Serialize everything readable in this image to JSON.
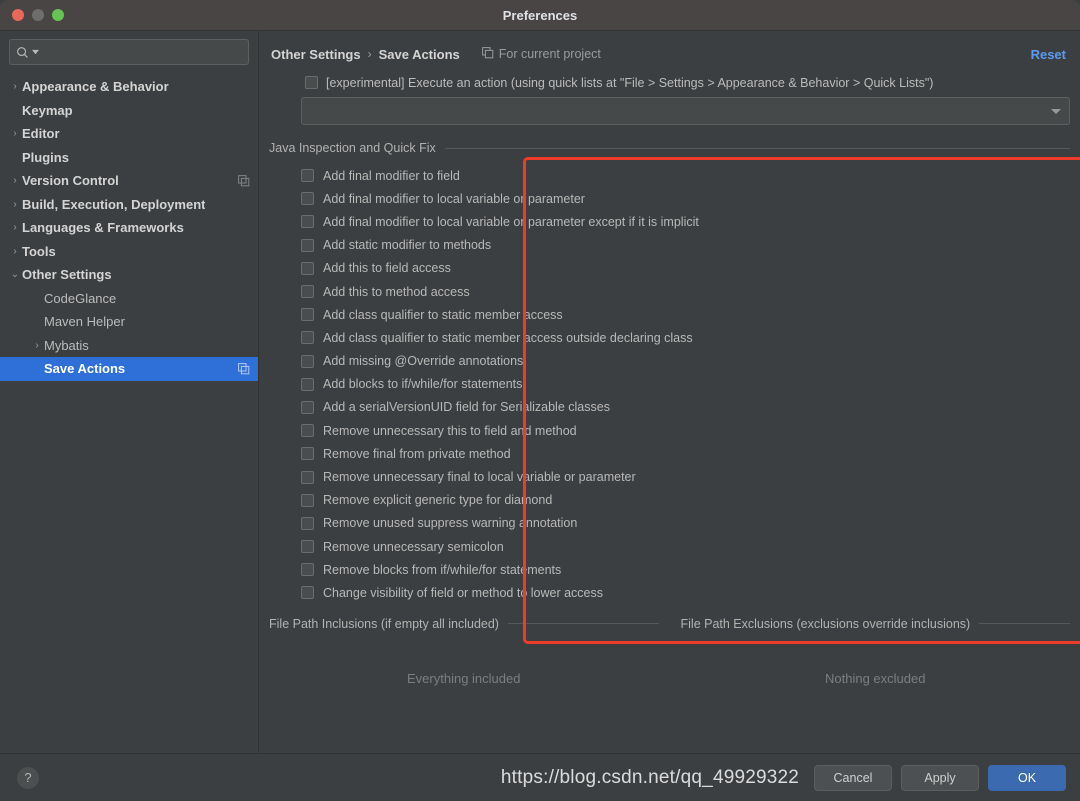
{
  "window": {
    "title": "Preferences",
    "traffic_lights": [
      "close-red",
      "minimize-yellow",
      "zoom-green"
    ]
  },
  "sidebar": {
    "search": {
      "value": "",
      "placeholder": "",
      "icon": "search-icon"
    },
    "items": [
      {
        "label": "Appearance & Behavior",
        "chevron": "›",
        "bold": true,
        "indent": 0,
        "selected": false,
        "trailing_icon": ""
      },
      {
        "label": "Keymap",
        "chevron": "",
        "bold": true,
        "indent": 0,
        "selected": false,
        "trailing_icon": ""
      },
      {
        "label": "Editor",
        "chevron": "›",
        "bold": true,
        "indent": 0,
        "selected": false,
        "trailing_icon": ""
      },
      {
        "label": "Plugins",
        "chevron": "",
        "bold": true,
        "indent": 0,
        "selected": false,
        "trailing_icon": ""
      },
      {
        "label": "Version Control",
        "chevron": "›",
        "bold": true,
        "indent": 0,
        "selected": false,
        "trailing_icon": "copy-icon"
      },
      {
        "label": "Build, Execution, Deployment",
        "chevron": "›",
        "bold": true,
        "indent": 0,
        "selected": false,
        "trailing_icon": ""
      },
      {
        "label": "Languages & Frameworks",
        "chevron": "›",
        "bold": true,
        "indent": 0,
        "selected": false,
        "trailing_icon": ""
      },
      {
        "label": "Tools",
        "chevron": "›",
        "bold": true,
        "indent": 0,
        "selected": false,
        "trailing_icon": ""
      },
      {
        "label": "Other Settings",
        "chevron": "⌄",
        "bold": true,
        "indent": 0,
        "selected": false,
        "trailing_icon": ""
      },
      {
        "label": "CodeGlance",
        "chevron": "",
        "bold": false,
        "indent": 1,
        "selected": false,
        "trailing_icon": ""
      },
      {
        "label": "Maven Helper",
        "chevron": "",
        "bold": false,
        "indent": 1,
        "selected": false,
        "trailing_icon": ""
      },
      {
        "label": "Mybatis",
        "chevron": "›",
        "bold": false,
        "indent": 1,
        "selected": false,
        "trailing_icon": ""
      },
      {
        "label": "Save Actions",
        "chevron": "",
        "bold": true,
        "indent": 1,
        "selected": true,
        "trailing_icon": "copy-icon"
      }
    ]
  },
  "main": {
    "breadcrumb": {
      "parent": "Other Settings",
      "separator": "›",
      "current": "Save Actions"
    },
    "for_current_project": {
      "label": "For current project",
      "icon": "copy-icon"
    },
    "reset_link": "Reset",
    "experimental": {
      "checked": false,
      "label": "[experimental] Execute an action (using quick lists at \"File > Settings > Appearance & Behavior > Quick Lists\")"
    },
    "action_combo": {
      "value": "",
      "arrow_icon": "chevron-down-icon"
    },
    "group": {
      "title": "Java Inspection and Quick Fix",
      "options": [
        {
          "label": "Add final modifier to field",
          "checked": false
        },
        {
          "label": "Add final modifier to local variable or parameter",
          "checked": false
        },
        {
          "label": "Add final modifier to local variable or parameter except if it is implicit",
          "checked": false
        },
        {
          "label": "Add static modifier to methods",
          "checked": false
        },
        {
          "label": "Add this to field access",
          "checked": false
        },
        {
          "label": "Add this to method access",
          "checked": false
        },
        {
          "label": "Add class qualifier to static member access",
          "checked": false
        },
        {
          "label": "Add class qualifier to static member access outside declaring class",
          "checked": false
        },
        {
          "label": "Add missing @Override annotations",
          "checked": false
        },
        {
          "label": "Add blocks to if/while/for statements",
          "checked": false
        },
        {
          "label": "Add a serialVersionUID field for Serializable classes",
          "checked": false
        },
        {
          "label": "Remove unnecessary this to field and method",
          "checked": false
        },
        {
          "label": "Remove final from private method",
          "checked": false
        },
        {
          "label": "Remove unnecessary final to local variable or parameter",
          "checked": false
        },
        {
          "label": "Remove explicit generic type for diamond",
          "checked": false
        },
        {
          "label": "Remove unused suppress warning annotation",
          "checked": false
        },
        {
          "label": "Remove unnecessary semicolon",
          "checked": false
        },
        {
          "label": "Remove blocks from if/while/for statements",
          "checked": false
        },
        {
          "label": "Change visibility of field or method to lower access",
          "checked": false
        }
      ]
    },
    "paths": {
      "inclusions": {
        "title": "File Path Inclusions (if empty all included)",
        "empty_text": "Everything included"
      },
      "exclusions": {
        "title": "File Path Exclusions (exclusions override inclusions)",
        "empty_text": "Nothing excluded"
      }
    },
    "annotation_box": {
      "color": "#f03b28"
    }
  },
  "bottom_bar": {
    "help_label": "?",
    "cancel_label": "Cancel",
    "apply_label": "Apply",
    "ok_label": "OK"
  },
  "watermark": "https://blog.csdn.net/qq_49929322",
  "colors": {
    "accent_blue": "#2f6fd8",
    "link_blue": "#5a9bf0",
    "primary_button": "#3c6ab0",
    "annotation_red": "#f03b28",
    "panel_bg": "#3c3f41",
    "titlebar_bg": "#4a4545"
  }
}
